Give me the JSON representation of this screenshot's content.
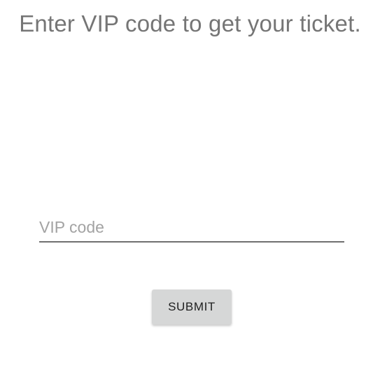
{
  "prompt": {
    "title": "Enter VIP code to get your ticket."
  },
  "form": {
    "vip_code": {
      "value": "",
      "placeholder": "VIP code"
    },
    "submit_label": "SUBMIT"
  },
  "colors": {
    "title_text": "#757575",
    "placeholder_text": "#a3a3a3",
    "input_underline": "#707070",
    "button_background": "#d6d7d7",
    "button_text": "#1f1f1f",
    "page_background": "#ffffff"
  }
}
